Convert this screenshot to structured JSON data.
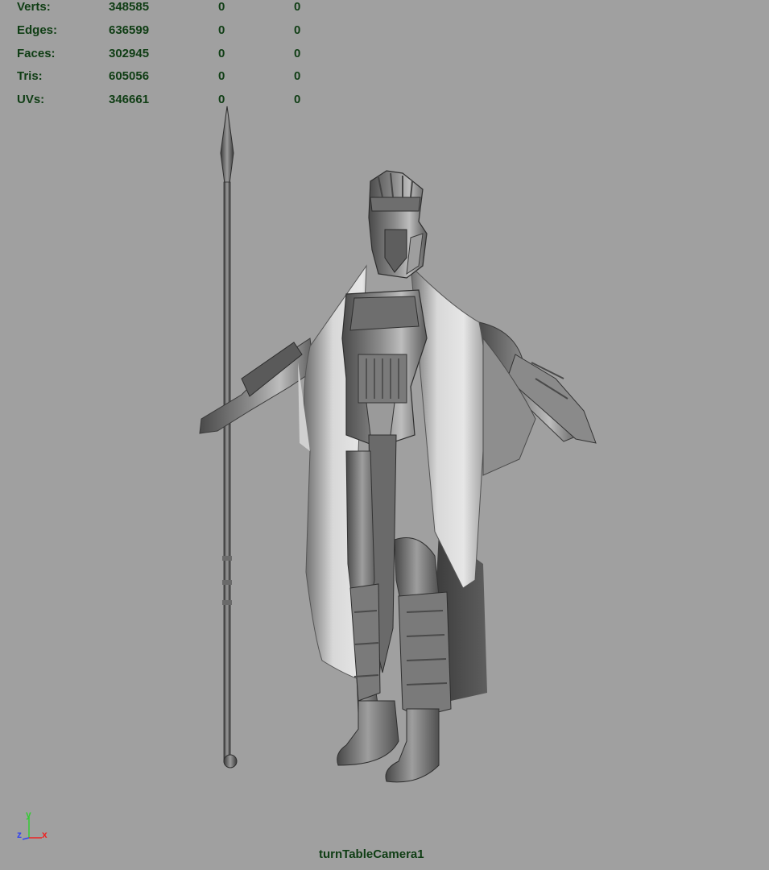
{
  "viewport": {
    "background": "#a0a0a0",
    "hud_color": "#0f3d14",
    "camera_name": "turnTableCamera1"
  },
  "hud": {
    "rows": [
      {
        "label": "Verts:",
        "total": "348585",
        "selected": "0",
        "component": "0"
      },
      {
        "label": "Edges:",
        "total": "636599",
        "selected": "0",
        "component": "0"
      },
      {
        "label": "Faces:",
        "total": "302945",
        "selected": "0",
        "component": "0"
      },
      {
        "label": "Tris:",
        "total": "605056",
        "selected": "0",
        "component": "0"
      },
      {
        "label": "UVs:",
        "total": "346661",
        "selected": "0",
        "component": "0"
      }
    ]
  },
  "axis": {
    "y_label": "y",
    "z_label": "z",
    "x_label": "x",
    "y_color": "#33cc33",
    "z_color": "#3344ee",
    "x_color": "#ee2222"
  }
}
